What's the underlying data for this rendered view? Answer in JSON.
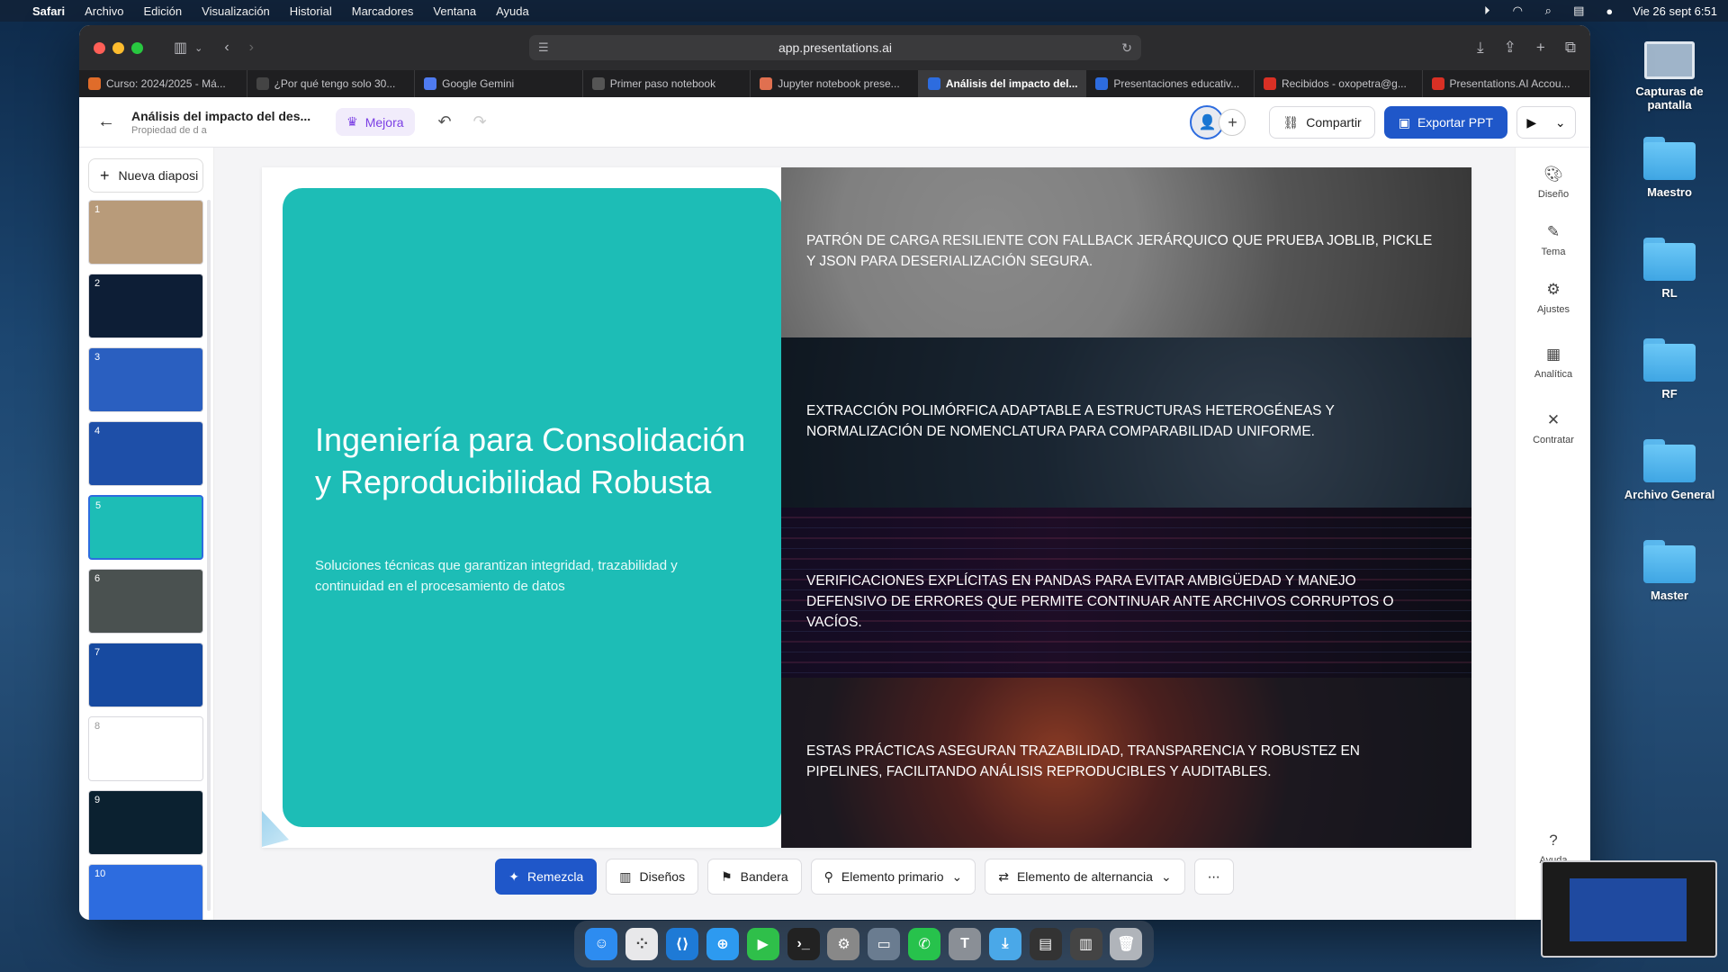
{
  "menubar": {
    "app": "Safari",
    "items": [
      "Archivo",
      "Edición",
      "Visualización",
      "Historial",
      "Marcadores",
      "Ventana",
      "Ayuda"
    ],
    "datetime": "Vie 26 sept  6:51"
  },
  "desktop": {
    "icons": [
      "Capturas de pantalla",
      "Maestro",
      "RL",
      "RF",
      "Archivo General",
      "Master"
    ]
  },
  "browser": {
    "url": "app.presentations.ai",
    "tabs": [
      {
        "label": "Curso: 2024/2025 - Má...",
        "color": "#e06c2a"
      },
      {
        "label": "¿Por qué tengo solo 30...",
        "color": "#444444"
      },
      {
        "label": "Google Gemini",
        "color": "#4f7bf0"
      },
      {
        "label": "Primer paso notebook",
        "color": "#555555"
      },
      {
        "label": "Jupyter notebook prese...",
        "color": "#e07050"
      },
      {
        "label": "Análisis del impacto del...",
        "color": "#2d6cdf"
      },
      {
        "label": "Presentaciones educativ...",
        "color": "#2d6cdf"
      },
      {
        "label": "Recibidos - oxopetra@g...",
        "color": "#d93025"
      },
      {
        "label": "Presentations.AI Accou...",
        "color": "#d93025"
      }
    ],
    "active_tab_index": 5
  },
  "app": {
    "doc_title": "Análisis del impacto del des...",
    "doc_subtitle": "Propiedad de d a",
    "upgrade_label": "Mejora",
    "share_label": "Compartir",
    "export_label": "Exportar PPT",
    "new_slide_label": "Nueva diaposi"
  },
  "thumbnails": [
    {
      "n": "1",
      "bg": "#b89b7a"
    },
    {
      "n": "2",
      "bg": "#0d1e36"
    },
    {
      "n": "3",
      "bg": "#2a5fc0"
    },
    {
      "n": "4",
      "bg": "#1e4fa8"
    },
    {
      "n": "5",
      "bg": "#1dbdb6"
    },
    {
      "n": "6",
      "bg": "#4a5150"
    },
    {
      "n": "7",
      "bg": "#174aa0"
    },
    {
      "n": "8",
      "bg": "#ffffff"
    },
    {
      "n": "9",
      "bg": "#0b2130"
    },
    {
      "n": "10",
      "bg": "#2d6cdf"
    }
  ],
  "slide": {
    "title": "Ingeniería para Consolidación y Reproducibilidad Robusta",
    "subtitle": "Soluciones técnicas que garantizan integridad, trazabilidad y continuidad en el procesamiento de datos",
    "rows": [
      "Patrón de carga resiliente con fallback jerárquico que prueba joblib, pickle y JSON para deserialización segura.",
      "Extracción polimórfica adaptable a estructuras heterogéneas y normalización de nomenclatura para comparabilidad uniforme.",
      "Verificaciones explícitas en pandas para evitar ambigüedad y manejo defensivo de errores que permite continuar ante archivos corruptos o vacíos.",
      "Estas prácticas aseguran trazabilidad, transparencia y robustez en pipelines, facilitando análisis reproducibles y auditables."
    ],
    "accent_color": "#1dbdb6"
  },
  "toolbar": {
    "remix": "Remezcla",
    "designs": "Diseños",
    "flag": "Bandera",
    "primary": "Elemento primario",
    "alternating": "Elemento de alternancia"
  },
  "rightrail": {
    "design": "Diseño",
    "theme": "Tema",
    "settings": "Ajustes",
    "analytics": "Analítica",
    "contract": "Contratar",
    "help": "Ayuda"
  },
  "colors": {
    "brand_blue": "#1f57c9",
    "upgrade_purple": "#7b3fe4"
  }
}
